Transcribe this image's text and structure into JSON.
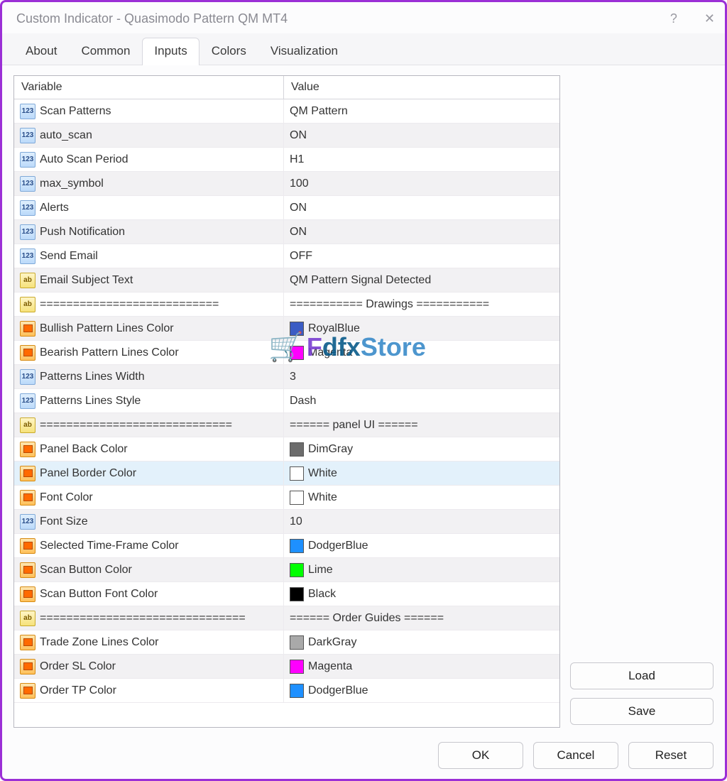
{
  "window": {
    "title": "Custom Indicator - Quasimodo Pattern QM MT4"
  },
  "tabs": [
    "About",
    "Common",
    "Inputs",
    "Colors",
    "Visualization"
  ],
  "activeTab": "Inputs",
  "headers": {
    "variable": "Variable",
    "value": "Value"
  },
  "rows": [
    {
      "icon": "num",
      "name": "Scan Patterns",
      "value": "QM Pattern",
      "shaded": false
    },
    {
      "icon": "num",
      "name": "auto_scan",
      "value": "ON",
      "shaded": true
    },
    {
      "icon": "num",
      "name": "Auto Scan Period",
      "value": "H1",
      "shaded": false
    },
    {
      "icon": "num",
      "name": "max_symbol",
      "value": "100",
      "shaded": true
    },
    {
      "icon": "num",
      "name": "Alerts",
      "value": "ON",
      "shaded": false
    },
    {
      "icon": "num",
      "name": "Push Notification",
      "value": "ON",
      "shaded": true
    },
    {
      "icon": "num",
      "name": "Send Email",
      "value": "OFF",
      "shaded": false
    },
    {
      "icon": "ab",
      "name": "Email Subject Text",
      "value": "QM Pattern Signal Detected",
      "shaded": true
    },
    {
      "icon": "ab",
      "name": "===========================",
      "value": "=========== Drawings ===========",
      "shaded": false
    },
    {
      "icon": "clr",
      "name": "Bullish Pattern Lines Color",
      "value": "RoyalBlue",
      "swatch": "#3b5cc4",
      "shaded": true
    },
    {
      "icon": "clr",
      "name": "Bearish Pattern Lines Color",
      "value": "Magenta",
      "swatch": "#ff00ff",
      "shaded": false
    },
    {
      "icon": "num",
      "name": "Patterns Lines Width",
      "value": "3",
      "shaded": true
    },
    {
      "icon": "num",
      "name": "Patterns Lines Style",
      "value": "Dash",
      "shaded": false
    },
    {
      "icon": "ab",
      "name": "=============================",
      "value": "====== panel UI ======",
      "shaded": true
    },
    {
      "icon": "clr",
      "name": "Panel Back Color",
      "value": "DimGray",
      "swatch": "#6c6c6c",
      "shaded": false
    },
    {
      "icon": "clr",
      "name": "Panel Border Color",
      "value": "White",
      "swatch": "#ffffff",
      "shaded": false,
      "selected": true
    },
    {
      "icon": "clr",
      "name": "Font Color",
      "value": "White",
      "swatch": "#ffffff",
      "shaded": false
    },
    {
      "icon": "num",
      "name": "Font Size",
      "value": "10",
      "shaded": true
    },
    {
      "icon": "clr",
      "name": "Selected Time-Frame Color",
      "value": "DodgerBlue",
      "swatch": "#1e90ff",
      "shaded": false
    },
    {
      "icon": "clr",
      "name": "Scan Button Color",
      "value": "Lime",
      "swatch": "#00ff00",
      "shaded": true
    },
    {
      "icon": "clr",
      "name": "Scan Button Font Color",
      "value": "Black",
      "swatch": "#000000",
      "shaded": false
    },
    {
      "icon": "ab",
      "name": "===============================",
      "value": "====== Order Guides ======",
      "shaded": true
    },
    {
      "icon": "clr",
      "name": "Trade Zone Lines Color",
      "value": "DarkGray",
      "swatch": "#a9a9a9",
      "shaded": false
    },
    {
      "icon": "clr",
      "name": "Order SL Color",
      "value": "Magenta",
      "swatch": "#ff00ff",
      "shaded": true
    },
    {
      "icon": "clr",
      "name": "Order TP Color",
      "value": "DodgerBlue",
      "swatch": "#1e90ff",
      "shaded": false
    }
  ],
  "buttons": {
    "load": "Load",
    "save": "Save",
    "ok": "OK",
    "cancel": "Cancel",
    "reset": "Reset"
  },
  "watermark": {
    "start": "F",
    "x": "dfx",
    "store": "Store"
  },
  "iconText": {
    "num": "123",
    "ab": "ab"
  }
}
